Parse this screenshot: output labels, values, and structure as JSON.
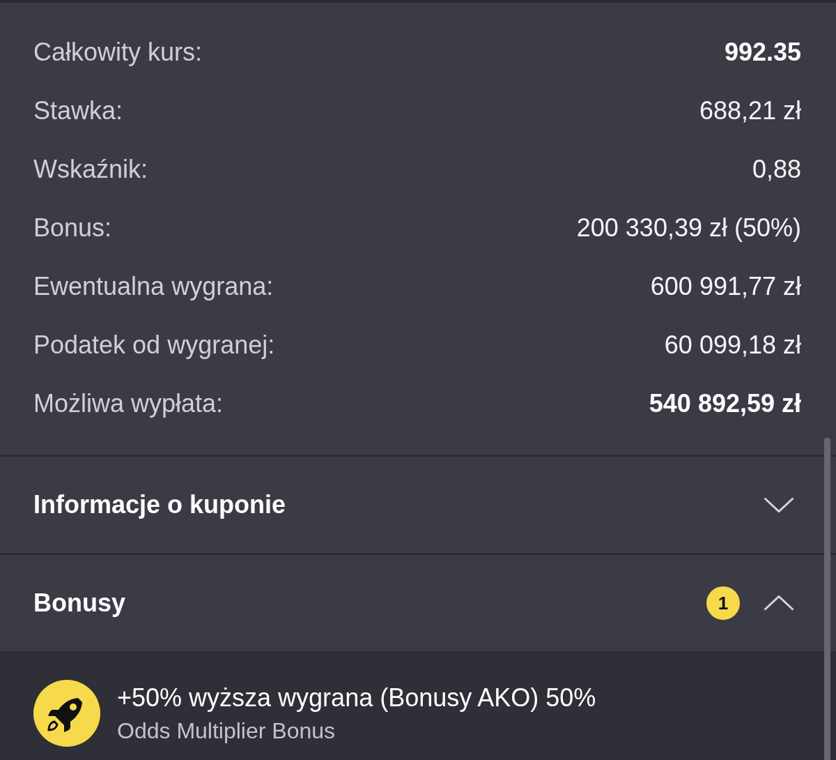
{
  "summary": {
    "rows": [
      {
        "label": "Całkowity kurs:",
        "value": "992.35",
        "bold": true
      },
      {
        "label": "Stawka:",
        "value": "688,21 zł",
        "bold": false
      },
      {
        "label": "Wskaźnik:",
        "value": "0,88",
        "bold": false
      },
      {
        "label": "Bonus:",
        "value": "200 330,39 zł (50%)",
        "bold": false
      },
      {
        "label": "Ewentualna wygrana:",
        "value": "600 991,77 zł",
        "bold": false
      },
      {
        "label": "Podatek od wygranej:",
        "value": "60 099,18 zł",
        "bold": false
      },
      {
        "label": "Możliwa wypłata:",
        "value": "540 892,59 zł",
        "bold": true
      }
    ]
  },
  "sections": [
    {
      "title": "Informacje o kuponie",
      "expanded": false
    },
    {
      "title": "Bonusy",
      "badge": "1",
      "expanded": true,
      "items": [
        {
          "title": "+50% wyższa wygrana (Bonusy AKO) 50%",
          "subtitle": "Odds Multiplier Bonus"
        }
      ]
    }
  ]
}
